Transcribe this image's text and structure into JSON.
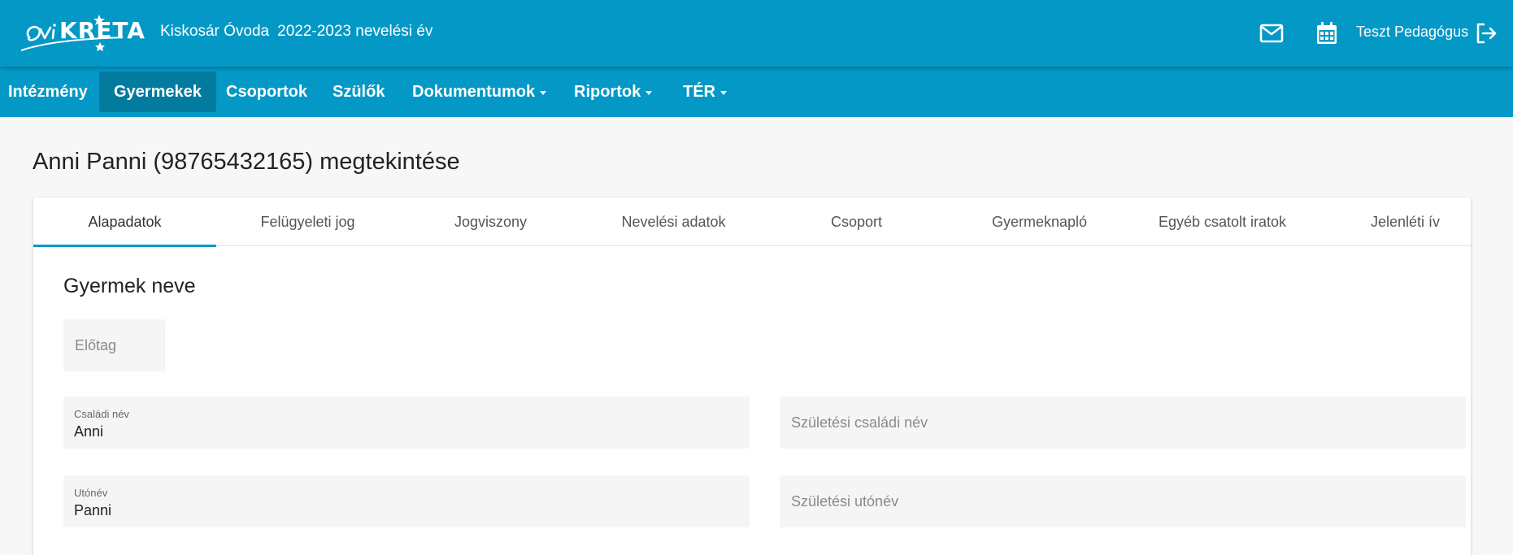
{
  "header": {
    "logo_text": "OviKRÉTA",
    "school_name": "Kiskosár Óvoda",
    "school_year": "2022-2023 nevelési év",
    "user_name": "Teszt Pedagógus",
    "icons": [
      "mail-icon",
      "calendar-icon",
      "logout-icon"
    ]
  },
  "nav": {
    "items": [
      {
        "label": "Intézmény",
        "dropdown": false,
        "active": false
      },
      {
        "label": "Gyermekek",
        "dropdown": false,
        "active": true
      },
      {
        "label": "Csoportok",
        "dropdown": false,
        "active": false
      },
      {
        "label": "Szülők",
        "dropdown": false,
        "active": false
      },
      {
        "label": "Dokumentumok",
        "dropdown": true,
        "active": false
      },
      {
        "label": "Riportok",
        "dropdown": true,
        "active": false
      },
      {
        "label": "TÉR",
        "dropdown": true,
        "active": false
      }
    ]
  },
  "page": {
    "title": "Anni Panni (98765432165) megtekintése"
  },
  "tabs": [
    {
      "label": "Alapadatok",
      "active": true
    },
    {
      "label": "Felügyeleti jog",
      "active": false
    },
    {
      "label": "Jogviszony",
      "active": false
    },
    {
      "label": "Nevelési adatok",
      "active": false
    },
    {
      "label": "Csoport",
      "active": false
    },
    {
      "label": "Gyermeknapló",
      "active": false
    },
    {
      "label": "Egyéb csatolt iratok",
      "active": false
    },
    {
      "label": "Jelenléti ív",
      "active": false
    }
  ],
  "form": {
    "section_title": "Gyermek neve",
    "prefix": {
      "placeholder": "Előtag",
      "value": ""
    },
    "family_name": {
      "label": "Családi név",
      "value": "Anni"
    },
    "birth_family_name": {
      "placeholder": "Születési családi név",
      "value": ""
    },
    "given_name": {
      "label": "Utónév",
      "value": "Panni"
    },
    "birth_given_name": {
      "placeholder": "Születési utónév",
      "value": ""
    }
  },
  "colors": {
    "brand": "#0398c5",
    "nav_active": "#037b9f",
    "page_bg": "#f7f7f7",
    "field_bg": "#f5f5f5"
  }
}
